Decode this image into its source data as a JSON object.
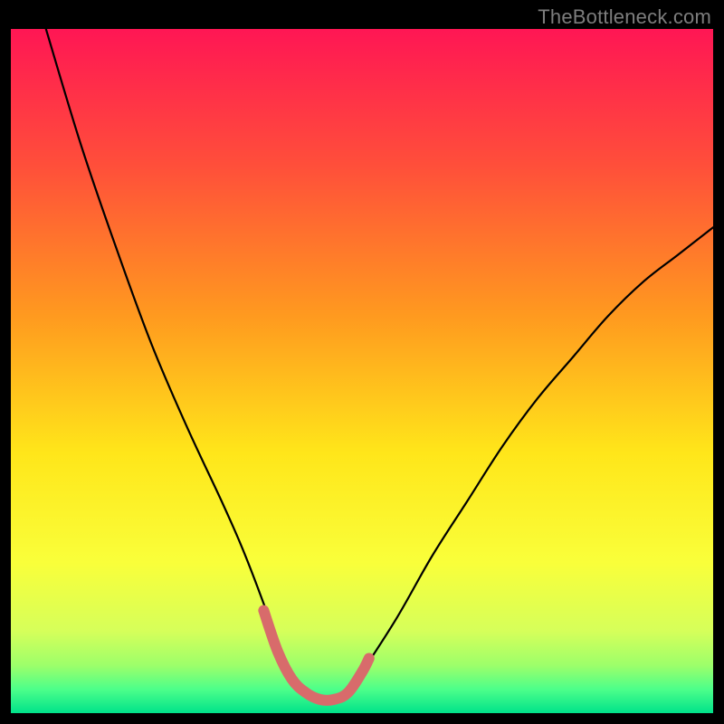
{
  "watermark": "TheBottleneck.com",
  "chart_data": {
    "type": "line",
    "title": "",
    "xlabel": "",
    "ylabel": "",
    "xlim": [
      0,
      100
    ],
    "ylim": [
      0,
      100
    ],
    "grid": false,
    "series": [
      {
        "name": "bottleneck-curve",
        "x": [
          5,
          10,
          15,
          20,
          25,
          30,
          33,
          36,
          38,
          40,
          42,
          45,
          48,
          50,
          55,
          60,
          65,
          70,
          75,
          80,
          85,
          90,
          95,
          100
        ],
        "y": [
          100,
          83,
          68,
          54,
          42,
          31,
          24,
          16,
          10,
          5,
          3,
          2,
          3,
          6,
          14,
          23,
          31,
          39,
          46,
          52,
          58,
          63,
          67,
          71
        ]
      },
      {
        "name": "optimal-band-marker",
        "x": [
          36,
          38,
          40,
          42,
          44,
          46,
          48,
          50,
          51
        ],
        "y": [
          15,
          9,
          5,
          3,
          2,
          2,
          3,
          6,
          8
        ]
      }
    ],
    "gradient_stops": [
      {
        "pos": 0.0,
        "color": "#ff1654"
      },
      {
        "pos": 0.2,
        "color": "#ff4f3a"
      },
      {
        "pos": 0.42,
        "color": "#ff9a1f"
      },
      {
        "pos": 0.62,
        "color": "#ffe61a"
      },
      {
        "pos": 0.78,
        "color": "#f9ff3a"
      },
      {
        "pos": 0.88,
        "color": "#d6ff5a"
      },
      {
        "pos": 0.93,
        "color": "#9dff6a"
      },
      {
        "pos": 0.965,
        "color": "#4dff8a"
      },
      {
        "pos": 1.0,
        "color": "#00e28a"
      }
    ]
  }
}
